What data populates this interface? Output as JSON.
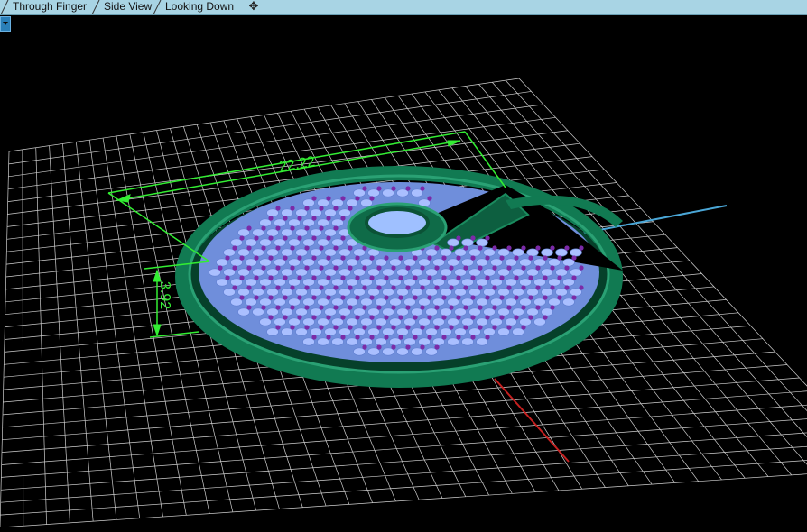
{
  "tabs": [
    {
      "label": "Through Finger"
    },
    {
      "label": "Side View"
    },
    {
      "label": "Looking Down"
    }
  ],
  "add_tab_glyph": "✥",
  "dropdown_icon": "chevron-down-icon",
  "dimensions": {
    "width_label": "22.22",
    "height_label": "3.92"
  },
  "colors": {
    "tab_bar": "#a8d4e4",
    "grid": "#d0d0d0",
    "dimension": "#33ee33",
    "ring": "#0f6b48",
    "stone": "#aabfff",
    "prong": "#7b2aa8",
    "axis_x": "#4aa6d6",
    "axis_y": "#c62020"
  }
}
